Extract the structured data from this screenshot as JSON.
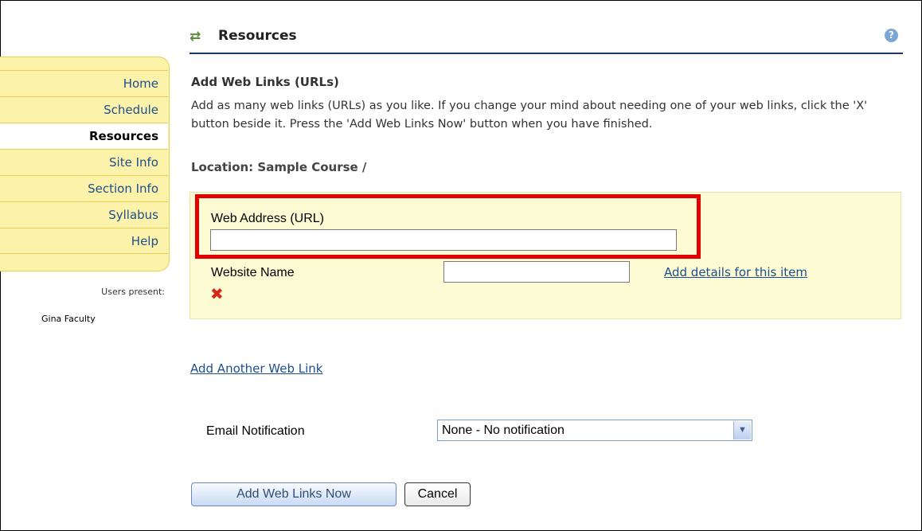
{
  "nav": {
    "items": [
      {
        "label": "Home"
      },
      {
        "label": "Schedule"
      },
      {
        "label": "Resources"
      },
      {
        "label": "Site Info"
      },
      {
        "label": "Section Info"
      },
      {
        "label": "Syllabus"
      },
      {
        "label": "Help"
      }
    ],
    "active": "Resources",
    "users_present_label": "Users present:",
    "users": [
      "Gina Faculty"
    ]
  },
  "header": {
    "icon": "refresh-arrows-icon",
    "title": "Resources",
    "help_icon": "help-icon"
  },
  "page": {
    "section_title": "Add Web Links (URLs)",
    "instructions": "Add as many web links (URLs) as you like. If you change your mind about needing one of your web links, click the 'X' button beside it. Press the 'Add Web Links Now' button when you have finished.",
    "location": "Location: Sample Course /"
  },
  "form": {
    "url_label": "Web Address (URL)",
    "url_value": "",
    "name_label": "Website Name",
    "name_value": "",
    "add_details_link": "Add details for this item",
    "delete_icon": "red-x-icon",
    "add_another_link": "Add Another Web Link",
    "email_label": "Email Notification",
    "email_selected": "None - No notification"
  },
  "buttons": {
    "submit": "Add Web Links Now",
    "cancel": "Cancel"
  },
  "colors": {
    "nav_bg": "#fcf2a9",
    "panel_bg": "#fcfbd3",
    "highlight": "#e40000",
    "link": "#1d4e8f",
    "header_rule": "#1b3a6b"
  }
}
